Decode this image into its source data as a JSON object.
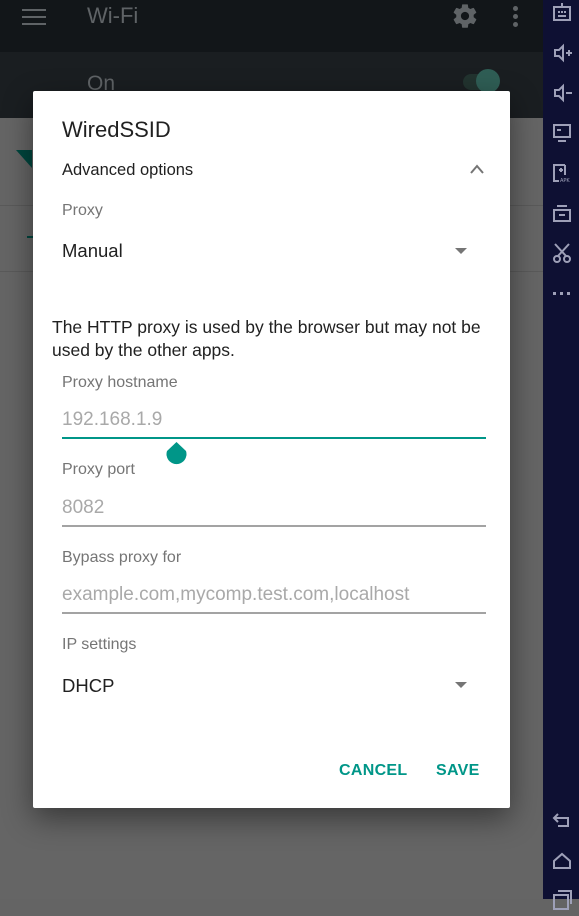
{
  "background_app": {
    "title": "Wi-Fi",
    "switch_label": "On",
    "switch_on": true
  },
  "dialog": {
    "title": "WiredSSID",
    "advanced_options_label": "Advanced options",
    "advanced_expanded": true,
    "proxy": {
      "label": "Proxy",
      "selected": "Manual"
    },
    "note": "The HTTP proxy is used by the browser but may not be used by the other apps.",
    "proxy_hostname": {
      "label": "Proxy hostname",
      "placeholder": "192.168.1.9",
      "value": ""
    },
    "proxy_port": {
      "label": "Proxy port",
      "placeholder": "8082",
      "value": ""
    },
    "bypass_proxy": {
      "label": "Bypass proxy for",
      "placeholder": "example.com,mycomp.test.com,localhost",
      "value": ""
    },
    "ip_settings": {
      "label": "IP settings",
      "selected": "DHCP"
    },
    "buttons": {
      "cancel": "CANCEL",
      "save": "SAVE"
    },
    "accent_color": "#009688"
  },
  "emulator_sidebar": {
    "icons": [
      "keyboard-icon",
      "volume-up-icon",
      "volume-down-icon",
      "screen-icon",
      "install-apk-icon",
      "print-icon",
      "cut-icon",
      "more-icon",
      "back-icon",
      "home-icon",
      "recents-icon"
    ]
  }
}
